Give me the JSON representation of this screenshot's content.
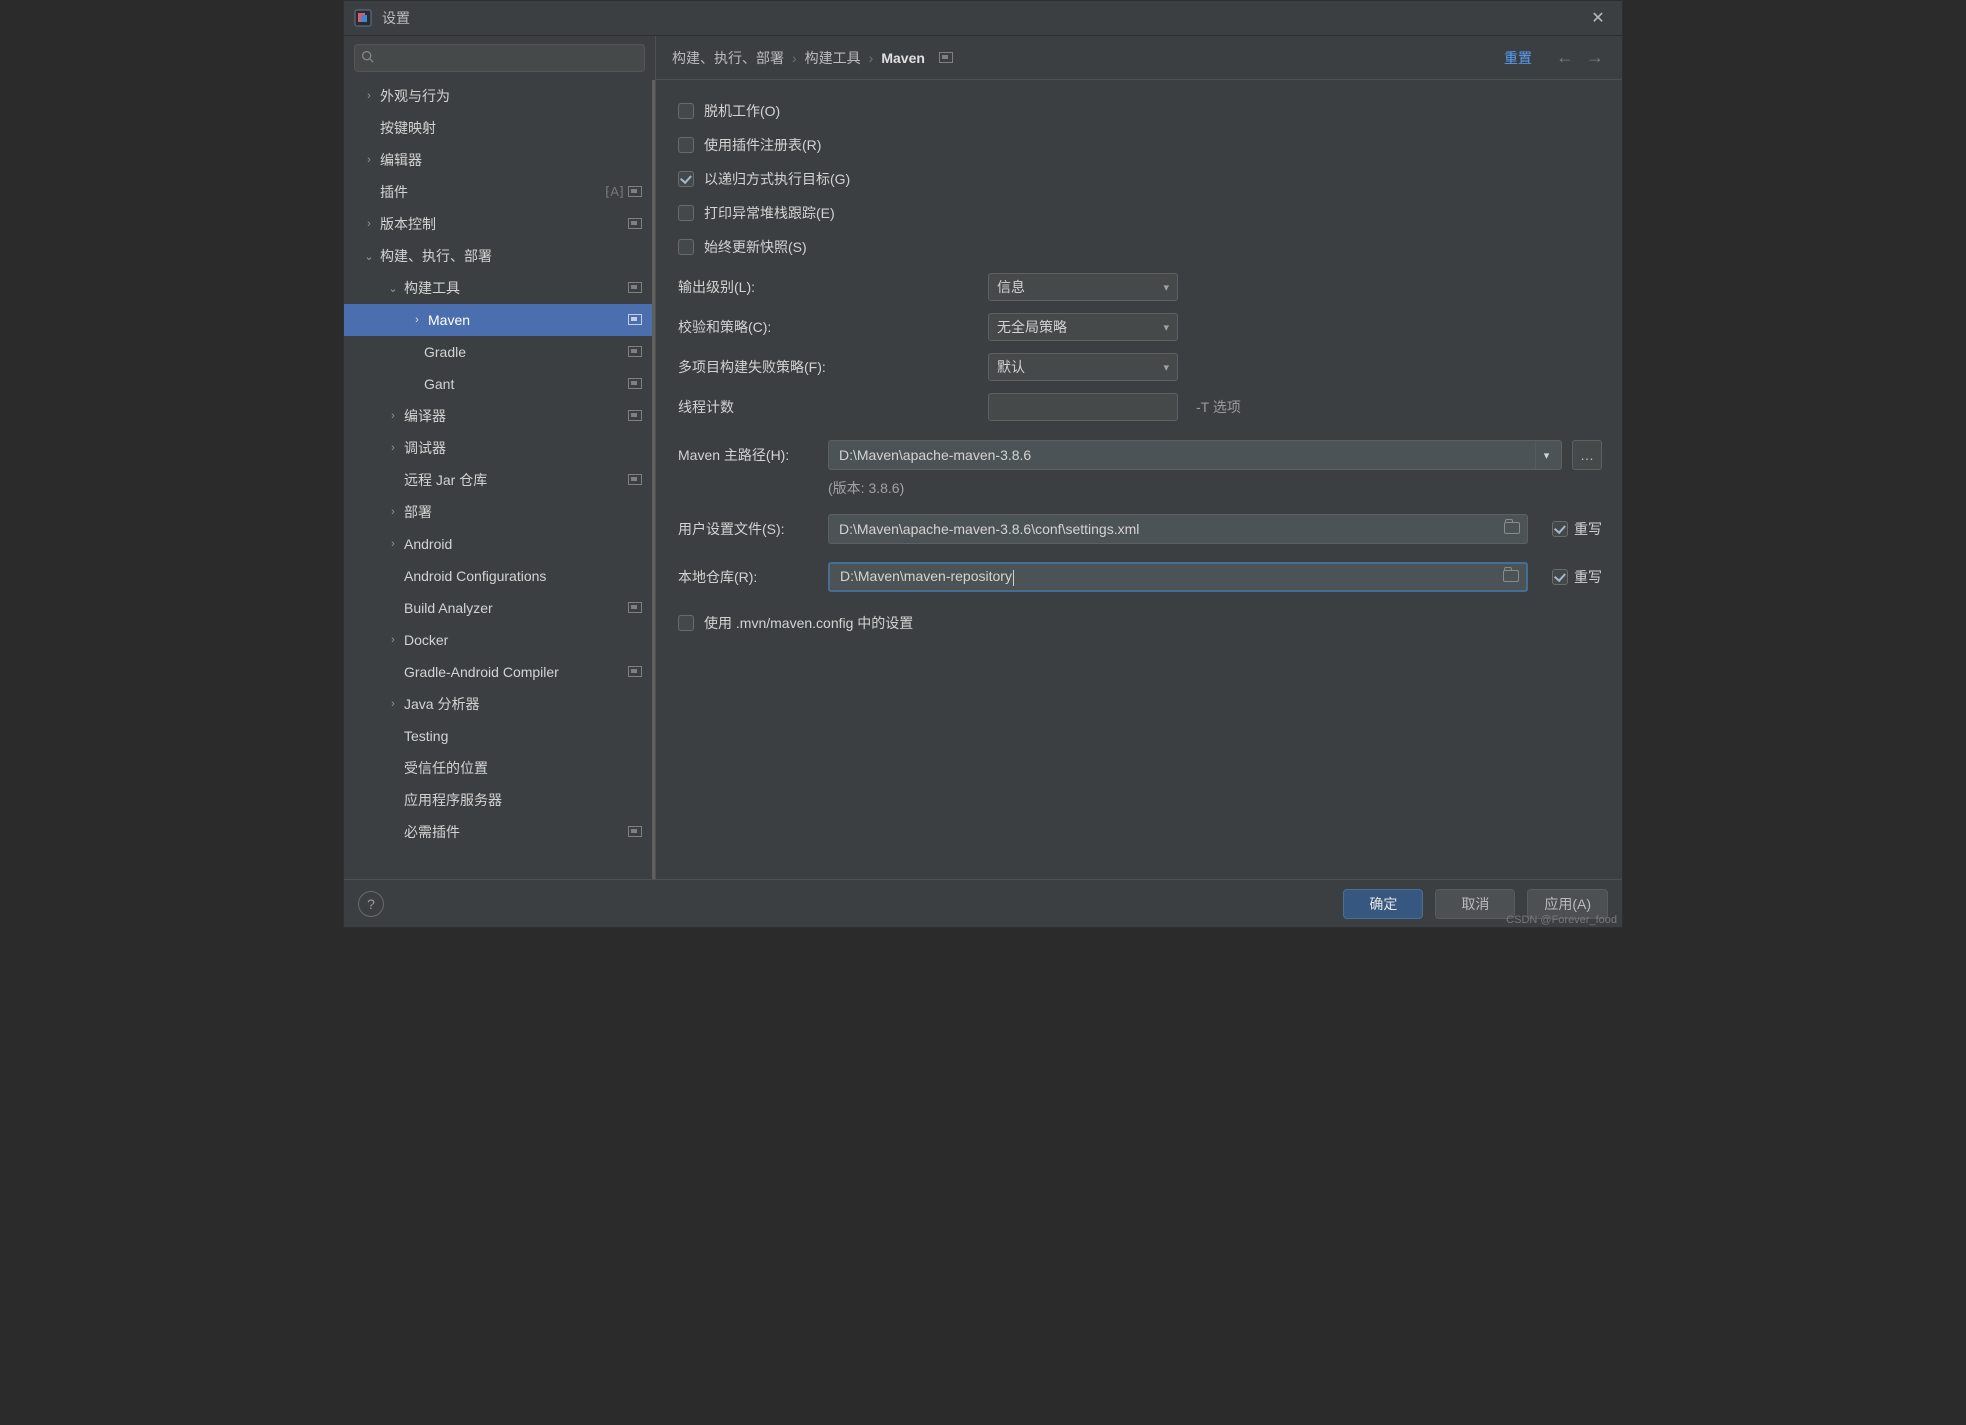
{
  "window": {
    "title": "设置"
  },
  "breadcrumb": {
    "a": "构建、执行、部署",
    "b": "构建工具",
    "c": "Maven",
    "reset": "重置"
  },
  "tree": {
    "appearance": "外观与行为",
    "keymap": "按键映射",
    "editor": "编辑器",
    "plugins": "插件",
    "vcs": "版本控制",
    "build": "构建、执行、部署",
    "buildtools": "构建工具",
    "maven": "Maven",
    "gradle": "Gradle",
    "gant": "Gant",
    "compiler": "编译器",
    "debugger": "调试器",
    "remotejar": "远程 Jar 仓库",
    "deployment": "部署",
    "android": "Android",
    "androidconf": "Android Configurations",
    "buildanalyzer": "Build Analyzer",
    "docker": "Docker",
    "gradleandroid": "Gradle-Android Compiler",
    "javaanal": "Java 分析器",
    "testing": "Testing",
    "trustedloc": "受信任的位置",
    "appservers": "应用程序服务器",
    "requiredplugins": "必需插件"
  },
  "form": {
    "offline": "脱机工作(O)",
    "registry": "使用插件注册表(R)",
    "recursive": "以递归方式执行目标(G)",
    "stacktrace": "打印异常堆栈跟踪(E)",
    "snapshot": "始终更新快照(S)",
    "outputlevel_label": "输出级别(L):",
    "outputlevel_value": "信息",
    "checksum_label": "校验和策略(C):",
    "checksum_value": "无全局策略",
    "failpolicy_label": "多项目构建失败策略(F):",
    "failpolicy_value": "默认",
    "threads_label": "线程计数",
    "threads_hint": "-T 选项",
    "mavenhome_label": "Maven 主路径(H):",
    "mavenhome_value": "D:\\Maven\\apache-maven-3.8.6",
    "version": "(版本: 3.8.6)",
    "usersettings_label": "用户设置文件(S):",
    "usersettings_value": "D:\\Maven\\apache-maven-3.8.6\\conf\\settings.xml",
    "localrepo_label": "本地仓库(R):",
    "localrepo_value": "D:\\Maven\\maven-repository",
    "override": "重写",
    "useconfig": "使用 .mvn/maven.config 中的设置"
  },
  "footer": {
    "ok": "确定",
    "cancel": "取消",
    "apply": "应用(A)"
  },
  "watermark": "CSDN @Forever_food"
}
